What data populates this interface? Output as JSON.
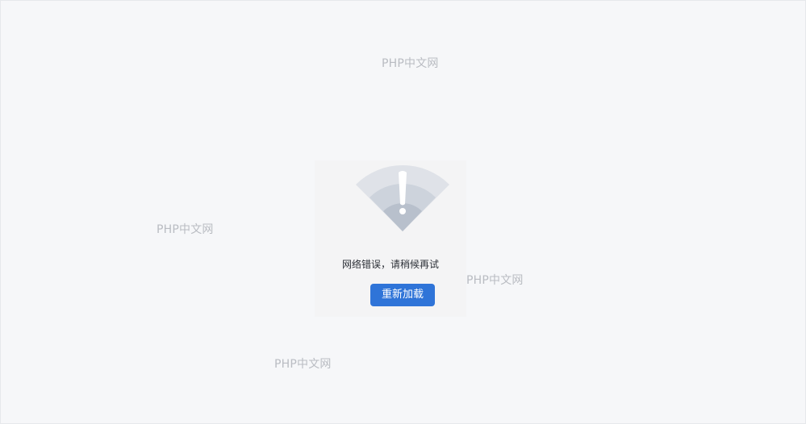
{
  "watermarks": [
    "PHP中文网",
    "PHP中文网",
    "PHP中文网",
    "PHP中文网"
  ],
  "error": {
    "icon": "wifi-warning-icon",
    "message": "网络错误，请稍候再试",
    "reload_label": "重新加载"
  },
  "colors": {
    "background": "#f6f7f9",
    "button": "#2f74d8",
    "icon_outer": "#dfe2e8",
    "icon_middle": "#cdd3dc",
    "icon_inner": "#b8c0cc"
  }
}
